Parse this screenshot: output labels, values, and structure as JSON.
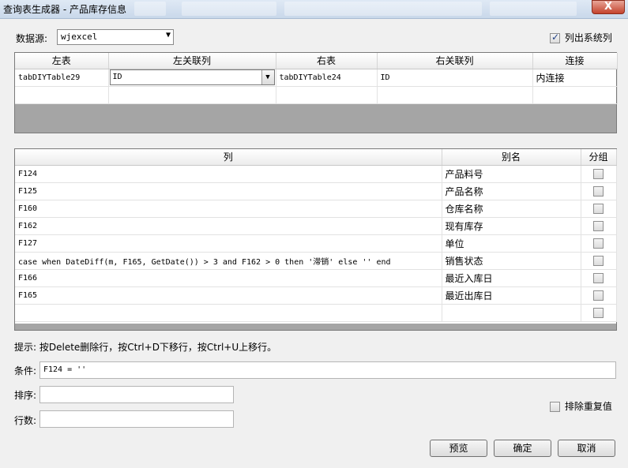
{
  "window": {
    "title": "查询表生成器 - 产品库存信息",
    "close_label": "X"
  },
  "datasource": {
    "label": "数据源:",
    "value": "wjexcel"
  },
  "list_system_columns": {
    "label": "列出系统列",
    "checked": true
  },
  "joins": {
    "headers": [
      "左表",
      "左关联列",
      "右表",
      "右关联列",
      "连接"
    ],
    "rows": [
      {
        "left_table": "tabDIYTable29",
        "left_col": "ID",
        "right_table": "tabDIYTable24",
        "right_col": "ID",
        "join": "内连接"
      }
    ]
  },
  "columns": {
    "headers": [
      "列",
      "别名",
      "分组"
    ],
    "rows": [
      {
        "col": "F124",
        "alias": "产品料号",
        "group": false
      },
      {
        "col": "F125",
        "alias": "产品名称",
        "group": false
      },
      {
        "col": "F160",
        "alias": "仓库名称",
        "group": false
      },
      {
        "col": "F162",
        "alias": "现有库存",
        "group": false
      },
      {
        "col": "F127",
        "alias": "单位",
        "group": false
      },
      {
        "col": "case when DateDiff(m, F165, GetDate()) > 3 and F162 > 0 then '滞销' else '' end",
        "alias": "销售状态",
        "group": false
      },
      {
        "col": "F166",
        "alias": "最近入库日",
        "group": false
      },
      {
        "col": "F165",
        "alias": "最近出库日",
        "group": false
      },
      {
        "col": "",
        "alias": "",
        "group": false
      }
    ]
  },
  "hint": "提示: 按Delete删除行，按Ctrl+D下移行，按Ctrl+U上移行。",
  "condition": {
    "label": "条件:",
    "value": "F124 = ''"
  },
  "sort": {
    "label": "排序:",
    "value": ""
  },
  "rows_count": {
    "label": "行数:",
    "value": ""
  },
  "distinct": {
    "label": "排除重复值",
    "checked": false
  },
  "buttons": {
    "preview": "预览",
    "ok": "确定",
    "cancel": "取消"
  }
}
